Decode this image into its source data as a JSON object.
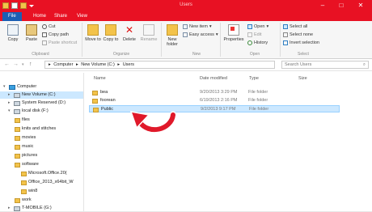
{
  "title": "Users",
  "tabs": [
    "File",
    "Home",
    "Share",
    "View"
  ],
  "ribbon": {
    "clipboard": {
      "copy": "Copy",
      "paste": "Paste",
      "cut": "Cut",
      "copy_path": "Copy path",
      "paste_shortcut": "Paste shortcut",
      "group": "Clipboard"
    },
    "organize": {
      "move_to": "Move to",
      "copy_to": "Copy to",
      "delete": "Delete",
      "rename": "Rename",
      "group": "Organize"
    },
    "new": {
      "new_folder": "New folder",
      "new_item": "New item",
      "easy_access": "Easy access",
      "group": "New"
    },
    "open": {
      "properties": "Properties",
      "open": "Open",
      "edit": "Edit",
      "history": "History",
      "group": "Open"
    },
    "select": {
      "select_all": "Select all",
      "select_none": "Select none",
      "invert": "Invert selection",
      "group": "Select"
    }
  },
  "address": {
    "parts": [
      "Computer",
      "New Volume (C:)",
      "Users"
    ],
    "search_placeholder": "Search Users"
  },
  "nav": [
    {
      "label": "Computer",
      "kind": "pc"
    },
    {
      "label": "New Volume (C:)",
      "kind": "drive"
    },
    {
      "label": "System Reserved (D:)",
      "kind": "drive"
    },
    {
      "label": "local disk (F:)",
      "kind": "drive"
    },
    {
      "label": "files",
      "kind": "folder"
    },
    {
      "label": "knits and stitches",
      "kind": "folder"
    },
    {
      "label": "movies",
      "kind": "folder"
    },
    {
      "label": "music",
      "kind": "folder"
    },
    {
      "label": "pictures",
      "kind": "folder"
    },
    {
      "label": "software",
      "kind": "folder"
    },
    {
      "label": "Microsoft.Office.20(",
      "kind": "folder"
    },
    {
      "label": "Office_2013_x64bit_W",
      "kind": "folder"
    },
    {
      "label": "win8",
      "kind": "folder"
    },
    {
      "label": "work",
      "kind": "folder"
    },
    {
      "label": "T-MOBILE (G:)",
      "kind": "drive"
    }
  ],
  "columns": {
    "name": "Name",
    "date": "Date modified",
    "type": "Type",
    "size": "Size"
  },
  "files": [
    {
      "name": "bea",
      "date": "9/20/2013 3:29 PM",
      "type": "File folder"
    },
    {
      "name": "foorean",
      "date": "6/19/2013 2:16 PM",
      "type": "File folder"
    },
    {
      "name": "Public",
      "date": "9/2/2013 9:17 PM",
      "type": "File folder"
    }
  ],
  "colors": {
    "titlebar": "#e81123",
    "file_tab": "#1a5fb4",
    "selection": "#cce8ff",
    "arrow": "#e0192a"
  }
}
